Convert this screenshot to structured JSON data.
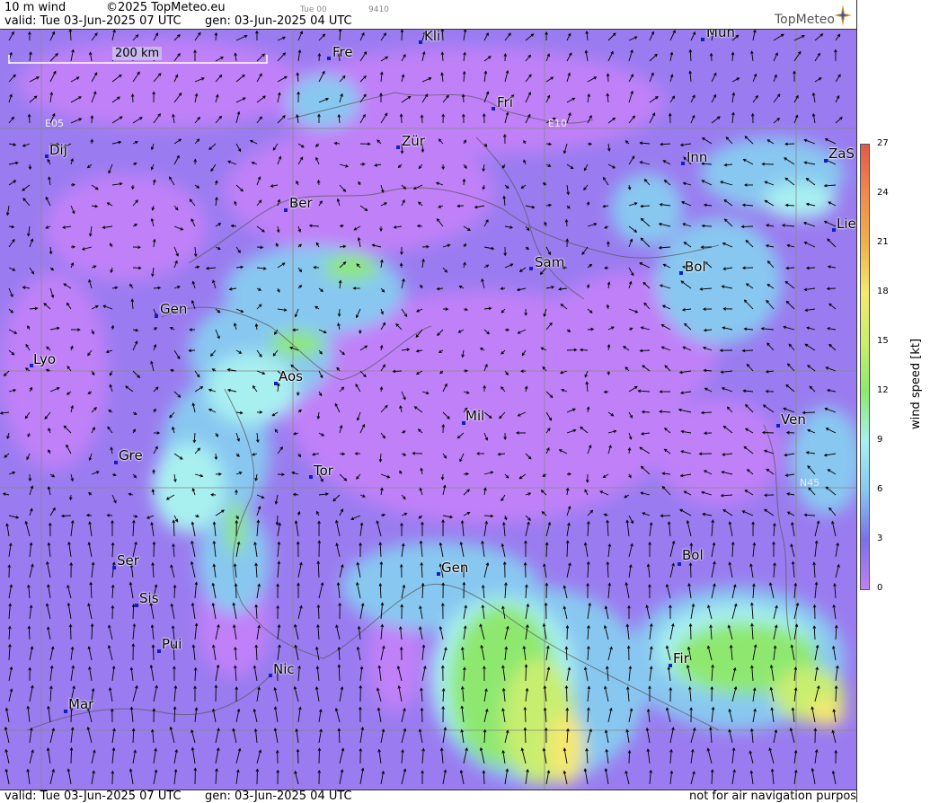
{
  "header": {
    "product": "10 m wind",
    "copyright": "©2025 TopMeteo.eu",
    "run_step": "Tue 00",
    "code": "9410",
    "valid": "valid:  Tue  03-Jun-2025  07 UTC",
    "gen": "gen: 03-Jun-2025 04 UTC",
    "logo": "TopMeteo"
  },
  "footer": {
    "valid": "valid:  Tue  03-Jun-2025  07 UTC",
    "gen": "gen: 03-Jun-2025 04 UTC",
    "disclaimer": "not for air navigation purposes"
  },
  "scale_bar": {
    "label": "200 km"
  },
  "grid_labels": [
    "E05",
    "E10",
    "N45"
  ],
  "colorbar": {
    "title": "wind speed [kt]",
    "ticks": [
      "27",
      "24",
      "21",
      "18",
      "15",
      "12",
      "9",
      "6",
      "3",
      "0"
    ],
    "colors": [
      "#e05a4a",
      "#f08a50",
      "#f0b050",
      "#f5e870",
      "#c8ee70",
      "#8ee870",
      "#a8f0f0",
      "#88c8f0",
      "#7a70e8",
      "#c080f8"
    ]
  },
  "cities": [
    {
      "name": "Kli"
    },
    {
      "name": "Mün"
    },
    {
      "name": "Fre"
    },
    {
      "name": "Fri"
    },
    {
      "name": "Dij"
    },
    {
      "name": "Zür"
    },
    {
      "name": "Inn"
    },
    {
      "name": "ZaS"
    },
    {
      "name": "Ber"
    },
    {
      "name": "Lie"
    },
    {
      "name": "Sam"
    },
    {
      "name": "Bol"
    },
    {
      "name": "Gen"
    },
    {
      "name": "Lyo"
    },
    {
      "name": "Aos"
    },
    {
      "name": "Mil"
    },
    {
      "name": "Ven"
    },
    {
      "name": "Gre"
    },
    {
      "name": "Tor"
    },
    {
      "name": "Gen"
    },
    {
      "name": "Bol"
    },
    {
      "name": "Ser"
    },
    {
      "name": "Sis"
    },
    {
      "name": "Pui"
    },
    {
      "name": "Fir"
    },
    {
      "name": "Nic"
    },
    {
      "name": "Mar"
    }
  ]
}
